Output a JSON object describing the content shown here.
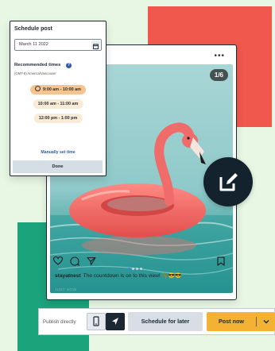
{
  "schedule_panel": {
    "title": "Schedule post",
    "date_value": "March 11 2022",
    "recommended_title": "Recommended times",
    "info_glyph": "?",
    "timezone": "(GMT-8) America/Vancouver",
    "slots": [
      "9:00 am - 10:00 am",
      "10:00 am - 11:00 am",
      "12:00 pm - 1:00 pm"
    ],
    "selected_slot_index": 0,
    "manual_label": "Manually set time",
    "done_label": "Done"
  },
  "post": {
    "menu_glyph": "•••",
    "slide_counter": "1/6",
    "carousel_dots": 4,
    "active_dot": 0,
    "username": "stayatnest",
    "caption": "The countdown is on to this view! 🌴😎😎",
    "time": "JUST NOW"
  },
  "action_bar": {
    "publish_label": "Publish directly",
    "schedule_later_label": "Schedule for later",
    "post_now_label": "Post now"
  },
  "colors": {
    "accent_orange": "#f3b233",
    "brand_navy": "#1b2733",
    "red_block": "#f0584d",
    "green_block": "#1ba37b"
  },
  "icons": [
    "calendar-icon",
    "info-icon",
    "clock-icon",
    "heart-icon",
    "comment-icon",
    "share-icon",
    "bookmark-icon",
    "edit-icon",
    "phone-icon",
    "send-icon",
    "chevron-down-icon"
  ]
}
